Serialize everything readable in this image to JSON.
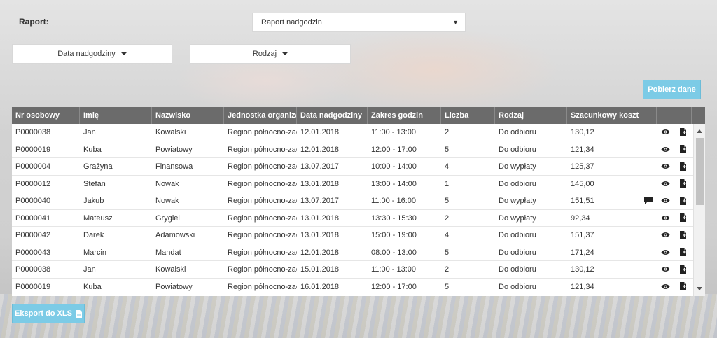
{
  "report": {
    "label": "Raport:",
    "selected": "Raport nadgodzin",
    "arrow": "▼"
  },
  "filters": [
    {
      "label": "Data nadgodziny"
    },
    {
      "label": "Rodzaj"
    }
  ],
  "buttons": {
    "fetch": "Pobierz dane",
    "export": "Eksport do XLS"
  },
  "table": {
    "columns": [
      "Nr osobowy",
      "Imię",
      "Nazwisko",
      "Jednostka organiza...",
      "Data nadgodziny",
      "Zakres godzin",
      "Liczba",
      "Rodzaj",
      "Szacunkowy koszt ..."
    ],
    "rows": [
      [
        "P0000038",
        "Jan",
        "Kowalski",
        "Region północno-zach...",
        "12.01.2018",
        "11:00 - 13:00",
        "2",
        "Do odbioru",
        "130,12"
      ],
      [
        "P0000019",
        "Kuba",
        "Powiatowy",
        "Region północno-zach...",
        "12.01.2018",
        "12:00 - 17:00",
        "5",
        "Do odbioru",
        "121,34"
      ],
      [
        "P0000004",
        "Grażyna",
        "Finansowa",
        "Region północno-zach...",
        "13.07.2017",
        "10:00 - 14:00",
        "4",
        "Do wypłaty",
        "125,37"
      ],
      [
        "P0000012",
        "Stefan",
        "Nowak",
        "Region północno-zach...",
        "13.01.2018",
        "13:00 - 14:00",
        "1",
        "Do odbioru",
        "145,00"
      ],
      [
        "P0000040",
        "Jakub",
        "Nowak",
        "Region północno-zach...",
        "13.07.2017",
        "11:00 - 16:00",
        "5",
        "Do wypłaty",
        "151,51"
      ],
      [
        "P0000041",
        "Mateusz",
        "Grygiel",
        "Region północno-zach...",
        "13.01.2018",
        "13:30 - 15:30",
        "2",
        "Do wypłaty",
        "92,34"
      ],
      [
        "P0000042",
        "Darek",
        "Adamowski",
        "Region północno-zach...",
        "13.01.2018",
        "15:00 - 19:00",
        "4",
        "Do odbioru",
        "151,37"
      ],
      [
        "P0000043",
        "Marcin",
        "Mandat",
        "Region północno-zach...",
        "12.01.2018",
        "08:00 - 13:00",
        "5",
        "Do odbioru",
        "171,24"
      ],
      [
        "P0000038",
        "Jan",
        "Kowalski",
        "Region północno-zach...",
        "15.01.2018",
        "11:00 - 13:00",
        "2",
        "Do odbioru",
        "130,12"
      ],
      [
        "P0000019",
        "Kuba",
        "Powiatowy",
        "Region północno-zach...",
        "16.01.2018",
        "12:00 - 17:00",
        "5",
        "Do odbioru",
        "121,34"
      ]
    ],
    "comment_rows": [
      4
    ]
  },
  "icons": {
    "view": "eye-icon",
    "document": "document-icon",
    "comment": "comment-icon"
  },
  "colors": {
    "header_bg": "#6b6b6b",
    "button_bg": "#7ccbe6"
  }
}
